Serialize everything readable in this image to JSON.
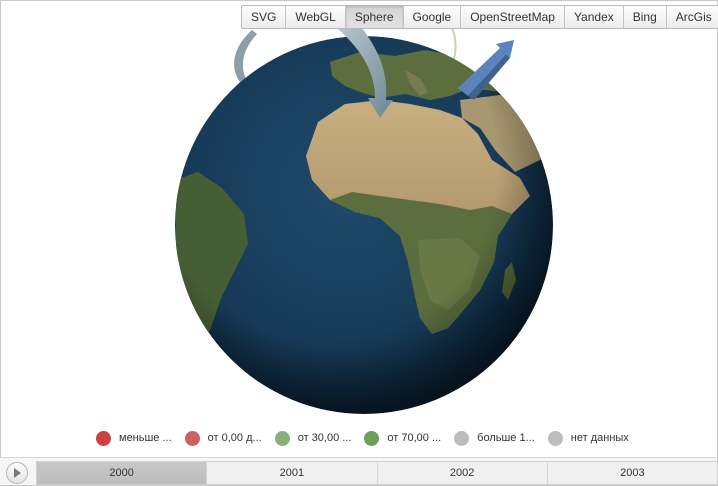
{
  "toolbar": {
    "buttons": [
      "SVG",
      "WebGL",
      "Sphere",
      "Google",
      "OpenStreetMap",
      "Yandex",
      "Bing",
      "ArcGis"
    ],
    "active": "Sphere"
  },
  "legend": {
    "items": [
      {
        "label": "меньше ...",
        "color": "#d04040"
      },
      {
        "label": "от 0,00 д...",
        "color": "#d06060"
      },
      {
        "label": "от 30,00 ...",
        "color": "#88b07a"
      },
      {
        "label": "от 70,00 ...",
        "color": "#6aa05a"
      },
      {
        "label": "больше 1...",
        "color": "#bdbdbd"
      },
      {
        "label": "нет данных",
        "color": "#bdbdbd"
      }
    ]
  },
  "timeline": {
    "years": [
      "2000",
      "2001",
      "2002",
      "2003"
    ],
    "active": "2000",
    "play_icon": "play-icon"
  },
  "colors": {
    "ocean": "#173c5a",
    "arrow_gray": "#8c9ea8",
    "arrow_blue": "#5b82b8"
  }
}
